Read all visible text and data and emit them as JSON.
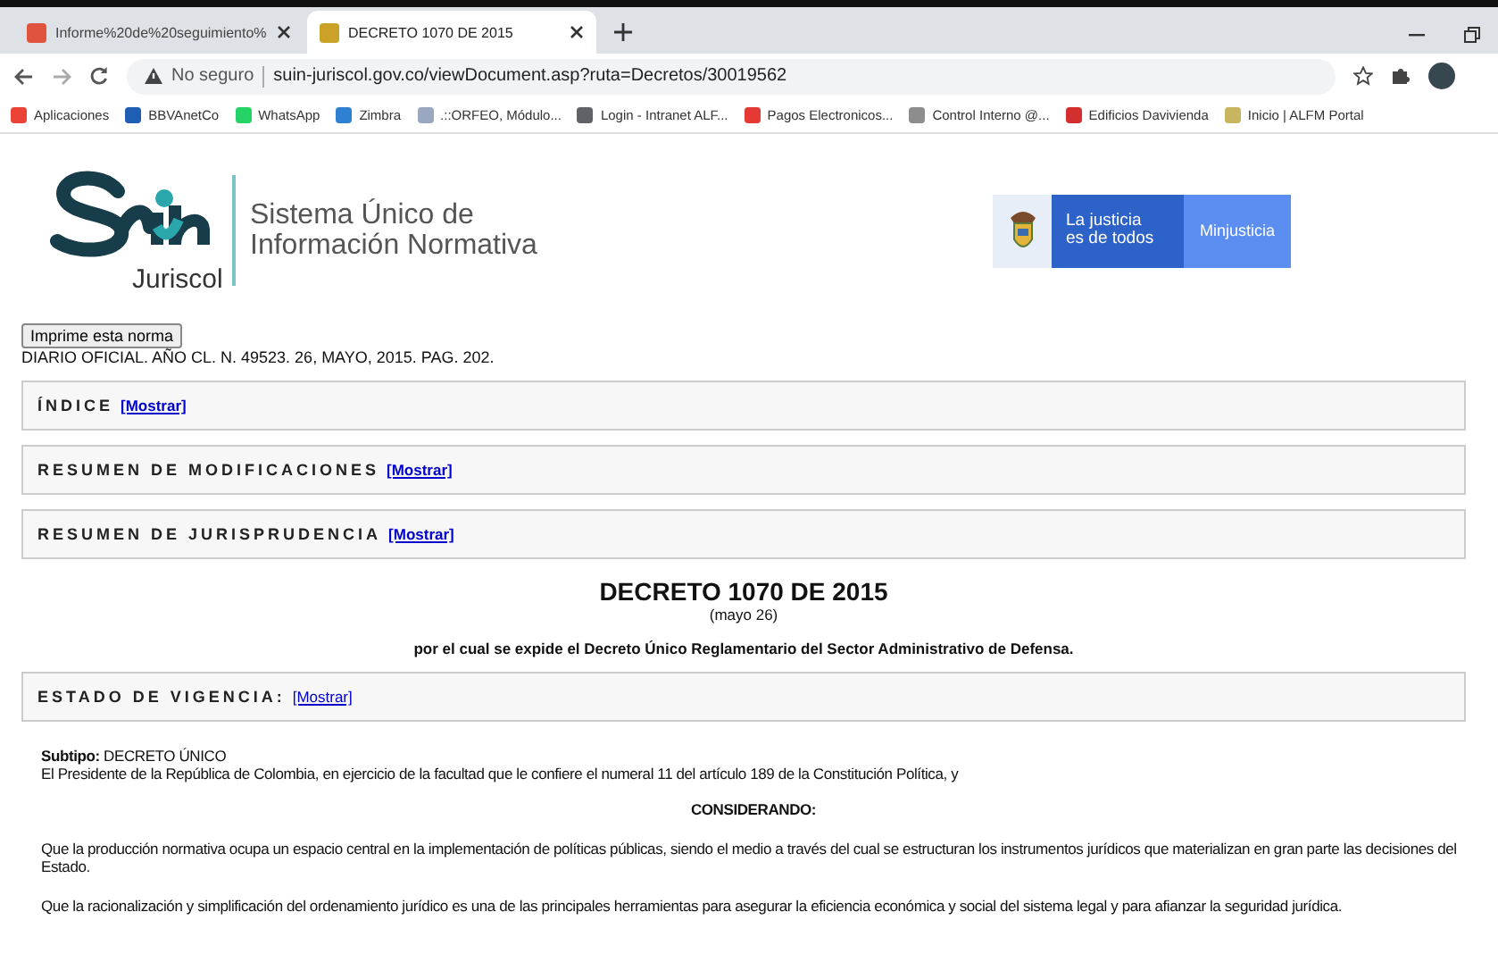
{
  "browser": {
    "tabs": [
      {
        "title": "Informe%20de%20seguimiento%",
        "selected": false,
        "color": "#e0533d"
      },
      {
        "title": "DECRETO 1070 DE 2015",
        "selected": true,
        "color": "#c9a227"
      }
    ],
    "address": {
      "security": "No seguro",
      "url": "suin-juriscol.gov.co/viewDocument.asp?ruta=Decretos/30019562"
    },
    "bookmarks": [
      {
        "label": "Aplicaciones",
        "color": "#ea4335"
      },
      {
        "label": "BBVAnetCo",
        "color": "#1e5fb4"
      },
      {
        "label": "WhatsApp",
        "color": "#25d366"
      },
      {
        "label": "Zimbra",
        "color": "#2f80d1"
      },
      {
        "label": ".::ORFEO, Módulo...",
        "color": "#9aa7c0"
      },
      {
        "label": "Login - Intranet ALF...",
        "color": "#5f6368"
      },
      {
        "label": "Pagos Electronicos...",
        "color": "#e53935"
      },
      {
        "label": "Control Interno @...",
        "color": "#8d8d8d"
      },
      {
        "label": "Edificios Davivienda",
        "color": "#d32f2f"
      },
      {
        "label": "Inicio | ALFM Portal",
        "color": "#c8b560"
      }
    ]
  },
  "header": {
    "logo_brand": "Juriscol",
    "logo_title": [
      "Sistema Único de",
      "Información Normativa"
    ],
    "banner": {
      "slogan": [
        "La justicia",
        "es de todos"
      ],
      "name": "Minjusticia"
    }
  },
  "print_button": "Imprime esta norma",
  "gazette": "DIARIO OFICIAL. AÑO CL. N. 49523. 26, MAYO, 2015. PAG. 202.",
  "sections": [
    {
      "title": "ÍNDICE",
      "link": "[Mostrar]"
    },
    {
      "title": "RESUMEN DE MODIFICACIONES",
      "link": "[Mostrar]"
    },
    {
      "title": "RESUMEN DE JURISPRUDENCIA",
      "link": "[Mostrar]"
    }
  ],
  "decree": {
    "title": "DECRETO 1070 DE 2015",
    "date": "(mayo 26)",
    "subtitle": "por el cual se expide el Decreto Único Reglamentario del Sector Administrativo de Defensa."
  },
  "vigencia": {
    "title": "ESTADO DE VIGENCIA:",
    "link": "[Mostrar]"
  },
  "body": {
    "subtype_label": "Subtipo:",
    "subtype": "DECRETO ÚNICO",
    "preamble": "El Presidente de la República de Colombia, en ejercicio de la facultad que le confiere el numeral 11 del artículo 189 de la Constitución Política, y",
    "heading": "CONSIDERANDO:",
    "paragraphs": [
      "Que la producción normativa ocupa un espacio central en la implementación de políticas públicas, siendo el medio a través del cual se estructuran los instrumentos jurídicos que materializan en gran parte las decisiones del Estado.",
      "Que la racionalización y simplificación del ordenamiento jurídico es una de las principales herramientas para asegurar la eficiencia económica y social del sistema legal y para afianzar la seguridad jurídica."
    ]
  }
}
